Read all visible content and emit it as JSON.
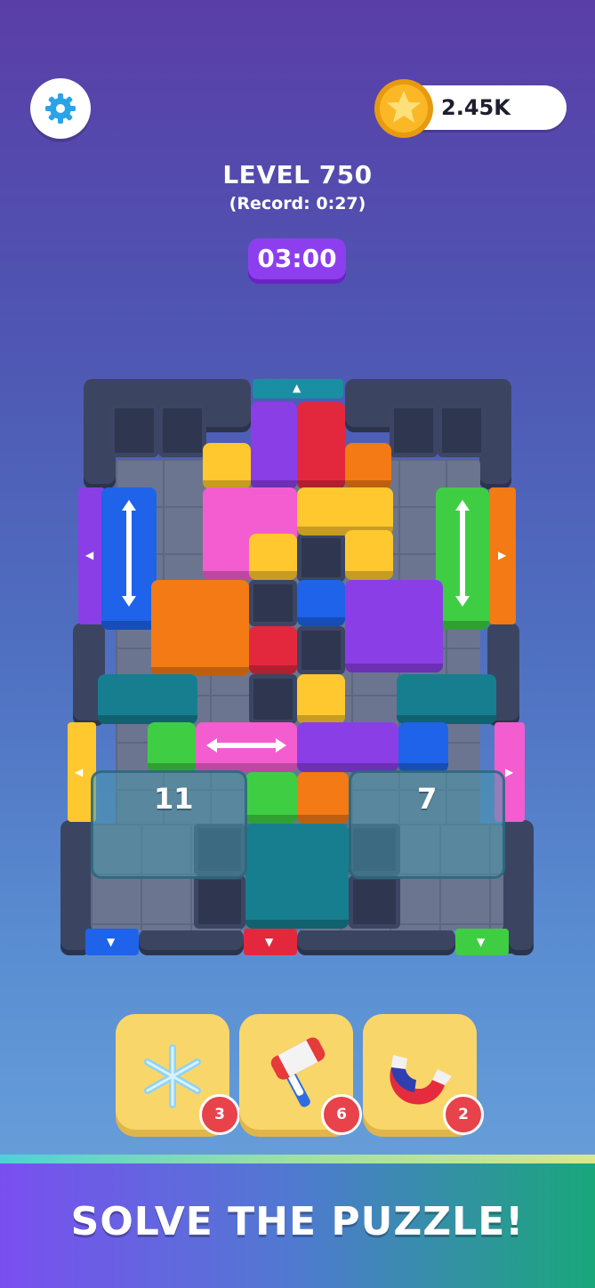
{
  "header": {
    "coins": "2.45K",
    "level_title": "LEVEL 750",
    "record": "(Record: 0:27)",
    "timer": "03:00"
  },
  "board": {
    "ice_blocks": [
      {
        "counter": "11"
      },
      {
        "counter": "7"
      }
    ],
    "gates": [
      "up",
      "left",
      "right",
      "left",
      "right",
      "down",
      "down",
      "down"
    ]
  },
  "boosters": [
    {
      "name": "freeze",
      "icon": "snowflake-icon",
      "count": "3"
    },
    {
      "name": "hammer",
      "icon": "hammer-icon",
      "count": "6"
    },
    {
      "name": "magnet",
      "icon": "magnet-icon",
      "count": "2"
    }
  ],
  "footer": {
    "slogan": "SOLVE THE PUZZLE!"
  },
  "colors": {
    "blue": "#1e63ea",
    "green": "#3fce43",
    "purple": "#8a3ee6",
    "red": "#e3283e",
    "orange": "#f37a14",
    "yellow": "#ffc82e",
    "pink": "#f45dcf",
    "teal": "#177e8f"
  }
}
